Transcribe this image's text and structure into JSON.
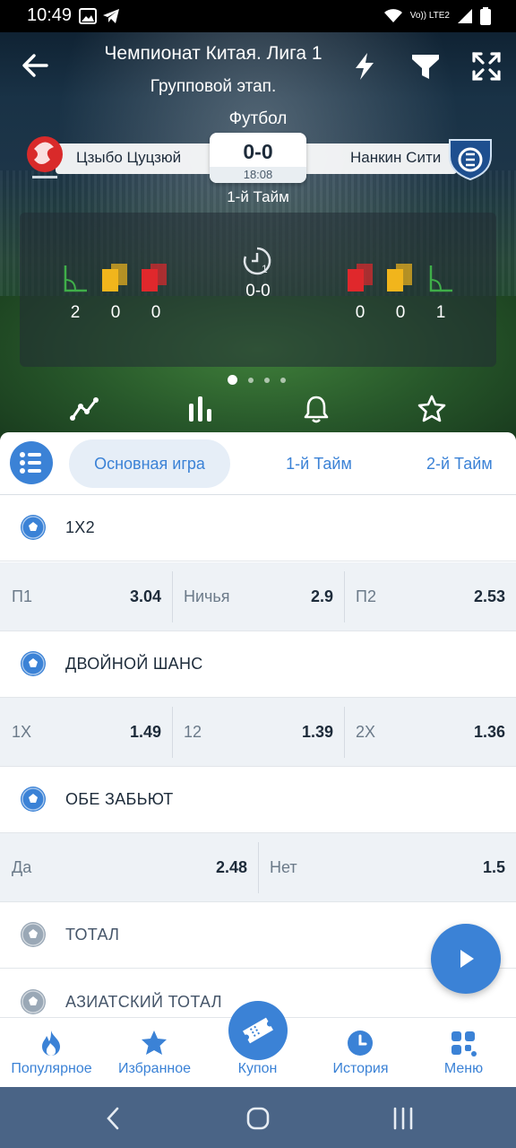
{
  "status_bar": {
    "time": "10:49",
    "network": "Vo)) LTE2"
  },
  "header": {
    "title": "Чемпионат Китая. Лига 1",
    "subtitle": "Групповой этап."
  },
  "match": {
    "sport": "Футбол",
    "home_team": "Цзыбо Цуцзюй",
    "away_team": "Нанкин Сити",
    "score": "0-0",
    "clock": "18:08",
    "period": "1-й Тайм",
    "home_stats": {
      "corners": "2",
      "yellow_cards": "0",
      "red_cards": "0"
    },
    "away_stats": {
      "red_cards": "0",
      "yellow_cards": "0",
      "corners": "1"
    },
    "half_score": "0-0",
    "half_score_badge": "1"
  },
  "tabs": [
    {
      "label": "Основная игра",
      "active": true
    },
    {
      "label": "1-й Тайм",
      "active": false
    },
    {
      "label": "2-й Тайм",
      "active": false
    }
  ],
  "markets": [
    {
      "name": "1X2",
      "odds": [
        {
          "label": "П1",
          "value": "3.04"
        },
        {
          "label": "Ничья",
          "value": "2.9"
        },
        {
          "label": "П2",
          "value": "2.53"
        }
      ]
    },
    {
      "name": "ДВОЙНОЙ ШАНС",
      "odds": [
        {
          "label": "1X",
          "value": "1.49"
        },
        {
          "label": "12",
          "value": "1.39"
        },
        {
          "label": "2X",
          "value": "1.36"
        }
      ]
    },
    {
      "name": "ОБЕ ЗАБЬЮТ",
      "odds": [
        {
          "label": "Да",
          "value": "2.48"
        },
        {
          "label": "Нет",
          "value": "1.5"
        }
      ]
    },
    {
      "name": "ТОТАЛ"
    },
    {
      "name": "АЗИАТСКИЙ ТОТАЛ"
    }
  ],
  "bottom_nav": [
    {
      "label": "Популярное",
      "icon": "fire-icon"
    },
    {
      "label": "Избранное",
      "icon": "star-icon"
    },
    {
      "label": "Купон",
      "icon": "ticket-icon"
    },
    {
      "label": "История",
      "icon": "clock-icon"
    },
    {
      "label": "Меню",
      "icon": "grid-icon"
    }
  ],
  "colors": {
    "accent": "#3b82d6",
    "odds_bg": "#eef2f6",
    "text": "#1d2b3a",
    "yellow_card": "#f1b51c",
    "red_card": "#e0282c",
    "corner": "#3fae49"
  }
}
